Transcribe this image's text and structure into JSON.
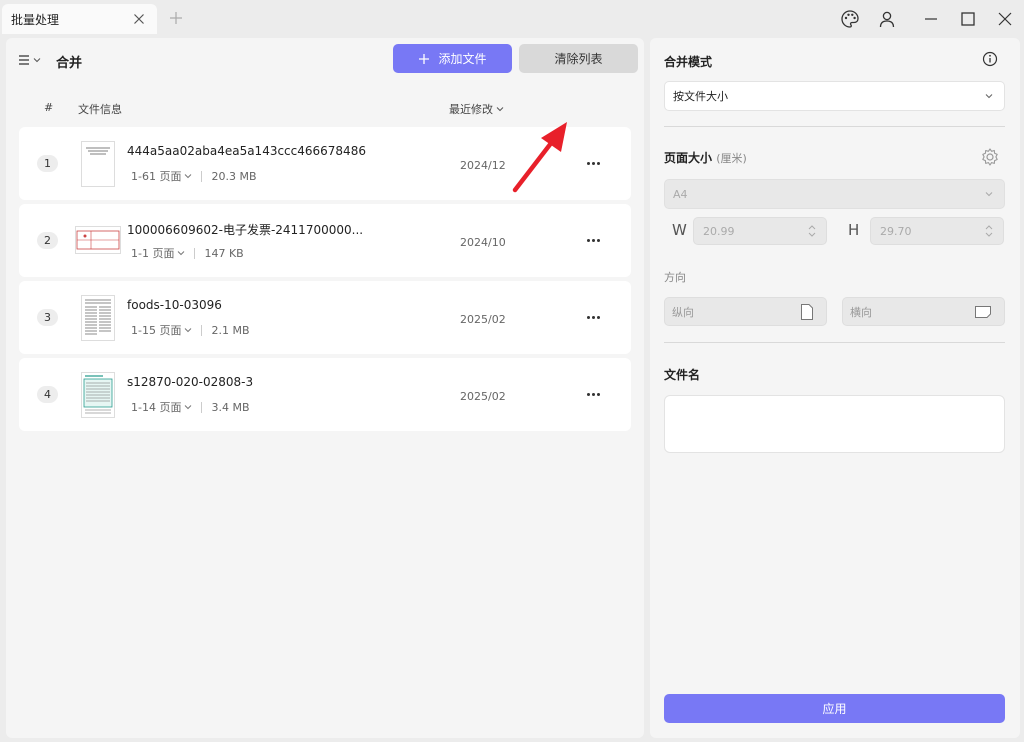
{
  "window": {
    "tab_title": "批量处理",
    "icons": [
      "close-icon",
      "plus-icon",
      "palette-icon",
      "user-icon",
      "minimize-icon",
      "maximize-icon",
      "window-close-icon"
    ]
  },
  "left": {
    "title": "合并",
    "add_button": "添加文件",
    "clear_button": "清除列表",
    "columns": {
      "num": "#",
      "info": "文件信息",
      "date": "最近修改"
    },
    "files": [
      {
        "num": "1",
        "name": "444a5aa02aba4ea5a143ccc466678486",
        "pages": "1-61 页面",
        "size": "20.3 MB",
        "date": "2024/12"
      },
      {
        "num": "2",
        "name": "100006609602-电子发票-2411700000...",
        "pages": "1-1 页面",
        "size": "147 KB",
        "date": "2024/10"
      },
      {
        "num": "3",
        "name": "foods-10-03096",
        "pages": "1-15 页面",
        "size": "2.1 MB",
        "date": "2025/02"
      },
      {
        "num": "4",
        "name": "s12870-020-02808-3",
        "pages": "1-14 页面",
        "size": "3.4 MB",
        "date": "2025/02"
      }
    ]
  },
  "right": {
    "merge_mode_label": "合并模式",
    "merge_mode_value": "按文件大小",
    "page_size_label": "页面大小",
    "page_size_unit": "(厘米)",
    "page_size_value": "A4",
    "w_label": "W",
    "w_value": "20.99",
    "h_label": "H",
    "h_value": "29.70",
    "orientation_label": "方向",
    "portrait": "纵向",
    "landscape": "横向",
    "filename_label": "文件名",
    "filename_value": "",
    "apply_button": "应用"
  },
  "colors": {
    "accent": "#7878f5",
    "arrow": "#e8202a"
  }
}
